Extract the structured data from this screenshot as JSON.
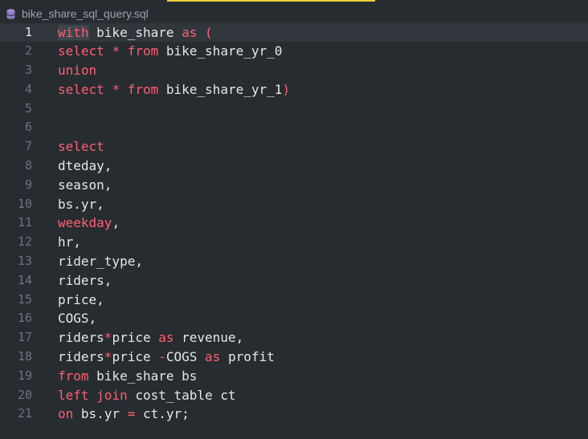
{
  "tab": {
    "file_name": "bike_share_sql_query.sql",
    "icon": "database-icon"
  },
  "colors": {
    "background": "#272c30",
    "keyword": "#ff5f73",
    "text": "#e7e7e7",
    "line_number": "#6b737b",
    "accent": "#f2d13a"
  },
  "editor": {
    "active_line": 1,
    "lines": [
      {
        "n": "1",
        "tokens": [
          {
            "t": "with",
            "c": "kw"
          },
          {
            "t": " bike_share ",
            "c": "id"
          },
          {
            "t": "as",
            "c": "kw"
          },
          {
            "t": " (",
            "c": "op"
          }
        ]
      },
      {
        "n": "2",
        "tokens": [
          {
            "t": "select",
            "c": "kw"
          },
          {
            "t": " ",
            "c": "id"
          },
          {
            "t": "*",
            "c": "op"
          },
          {
            "t": " ",
            "c": "id"
          },
          {
            "t": "from",
            "c": "kw"
          },
          {
            "t": " bike_share_yr_0",
            "c": "id"
          }
        ]
      },
      {
        "n": "3",
        "tokens": [
          {
            "t": "union",
            "c": "kw"
          }
        ]
      },
      {
        "n": "4",
        "tokens": [
          {
            "t": "select",
            "c": "kw"
          },
          {
            "t": " ",
            "c": "id"
          },
          {
            "t": "*",
            "c": "op"
          },
          {
            "t": " ",
            "c": "id"
          },
          {
            "t": "from",
            "c": "kw"
          },
          {
            "t": " bike_share_yr_1",
            "c": "id"
          },
          {
            "t": ")",
            "c": "op"
          }
        ]
      },
      {
        "n": "5",
        "tokens": []
      },
      {
        "n": "6",
        "tokens": []
      },
      {
        "n": "7",
        "tokens": [
          {
            "t": "select",
            "c": "kw"
          }
        ]
      },
      {
        "n": "8",
        "tokens": [
          {
            "t": "dteday,",
            "c": "id"
          }
        ]
      },
      {
        "n": "9",
        "tokens": [
          {
            "t": "season,",
            "c": "id"
          }
        ]
      },
      {
        "n": "10",
        "tokens": [
          {
            "t": "bs.yr,",
            "c": "id"
          }
        ]
      },
      {
        "n": "11",
        "tokens": [
          {
            "t": "weekday",
            "c": "kw"
          },
          {
            "t": ",",
            "c": "id"
          }
        ]
      },
      {
        "n": "12",
        "tokens": [
          {
            "t": "hr,",
            "c": "id"
          }
        ]
      },
      {
        "n": "13",
        "tokens": [
          {
            "t": "rider_type,",
            "c": "id"
          }
        ]
      },
      {
        "n": "14",
        "tokens": [
          {
            "t": "riders,",
            "c": "id"
          }
        ]
      },
      {
        "n": "15",
        "tokens": [
          {
            "t": "price,",
            "c": "id"
          }
        ]
      },
      {
        "n": "16",
        "tokens": [
          {
            "t": "COGS,",
            "c": "id"
          }
        ]
      },
      {
        "n": "17",
        "tokens": [
          {
            "t": "riders",
            "c": "id"
          },
          {
            "t": "*",
            "c": "op"
          },
          {
            "t": "price ",
            "c": "id"
          },
          {
            "t": "as",
            "c": "kw"
          },
          {
            "t": " revenue,",
            "c": "id"
          }
        ]
      },
      {
        "n": "18",
        "tokens": [
          {
            "t": "riders",
            "c": "id"
          },
          {
            "t": "*",
            "c": "op"
          },
          {
            "t": "price ",
            "c": "id"
          },
          {
            "t": "-",
            "c": "op"
          },
          {
            "t": "COGS ",
            "c": "id"
          },
          {
            "t": "as",
            "c": "kw"
          },
          {
            "t": " profit",
            "c": "id"
          }
        ]
      },
      {
        "n": "19",
        "tokens": [
          {
            "t": "from",
            "c": "kw"
          },
          {
            "t": " bike_share bs",
            "c": "id"
          }
        ]
      },
      {
        "n": "20",
        "tokens": [
          {
            "t": "left",
            "c": "kw"
          },
          {
            "t": " ",
            "c": "id"
          },
          {
            "t": "join",
            "c": "kw"
          },
          {
            "t": " cost_table ct",
            "c": "id"
          }
        ]
      },
      {
        "n": "21",
        "tokens": [
          {
            "t": "on",
            "c": "kw"
          },
          {
            "t": " bs.yr ",
            "c": "id"
          },
          {
            "t": "=",
            "c": "op"
          },
          {
            "t": " ct.yr;",
            "c": "id"
          }
        ]
      }
    ]
  }
}
